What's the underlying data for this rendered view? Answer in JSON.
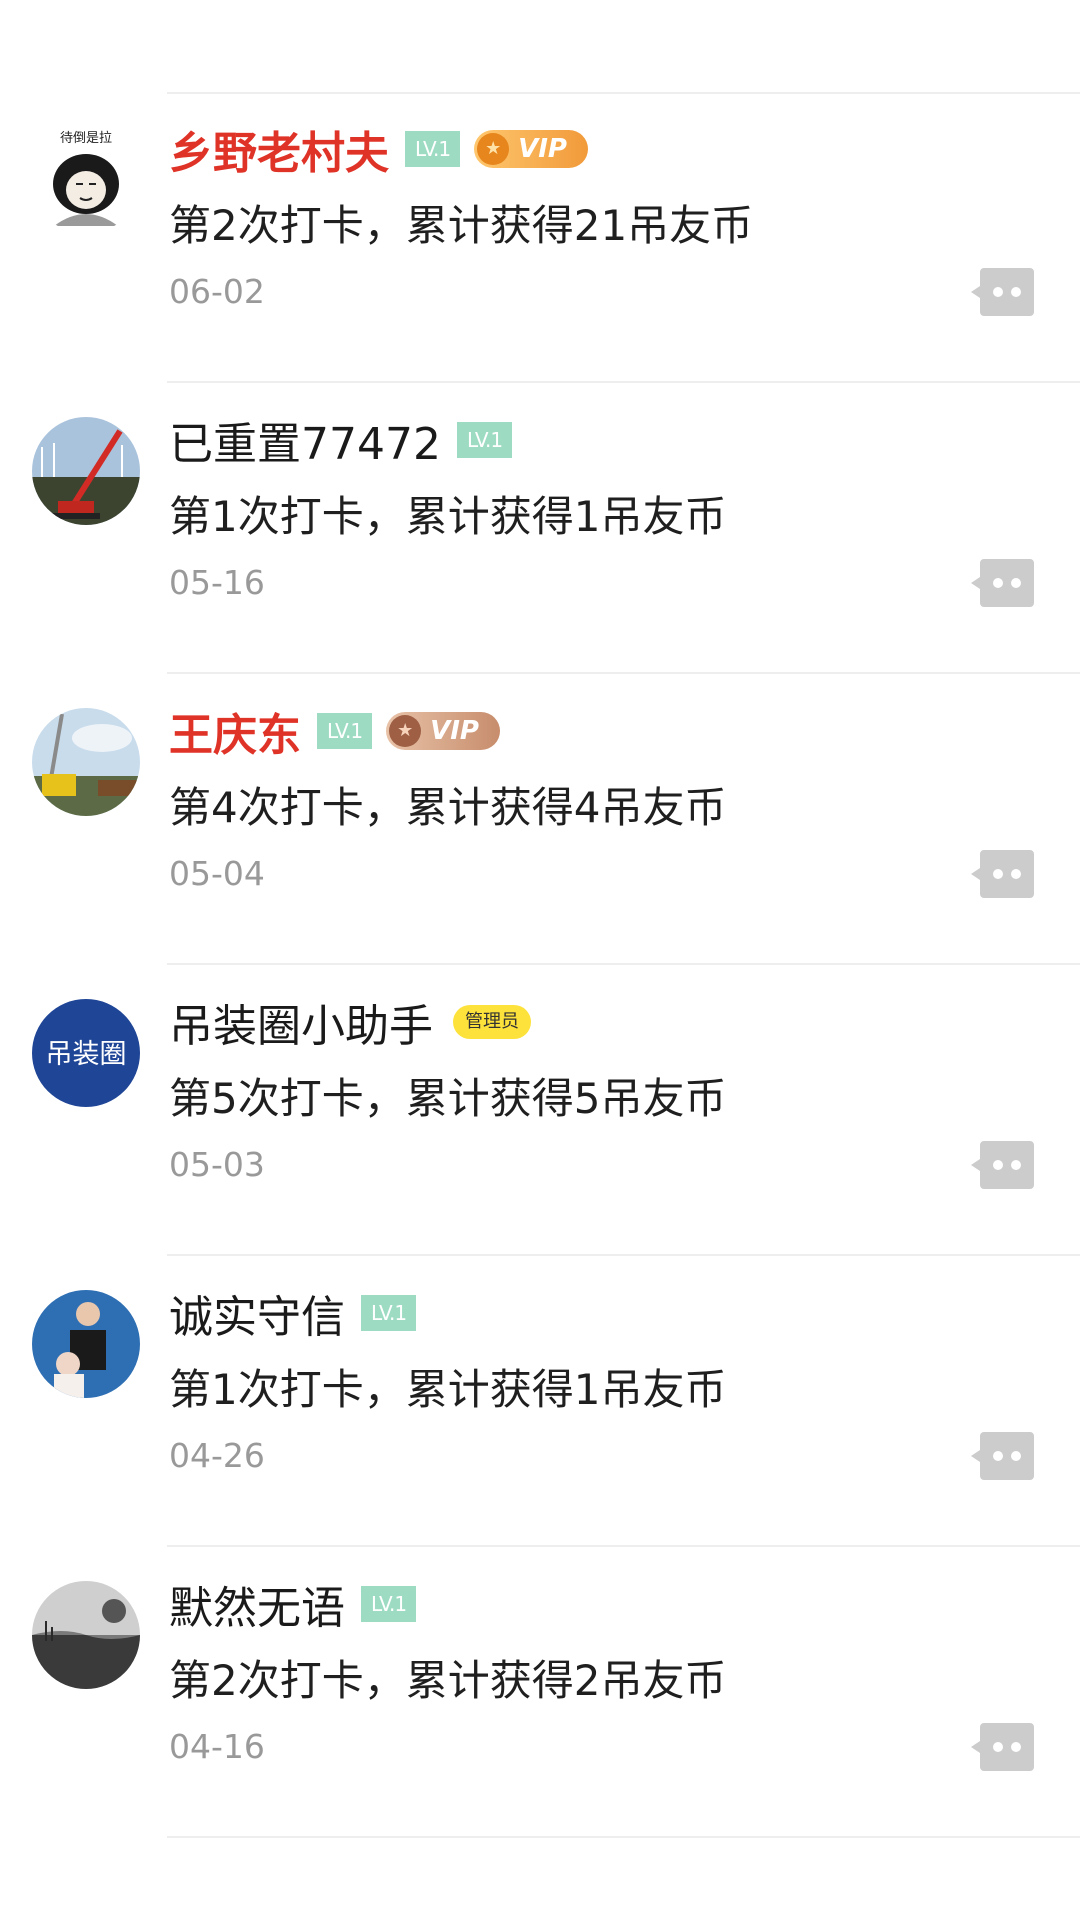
{
  "checkins": [
    {
      "username": "乡野老村夫",
      "level": "LV.1",
      "vip": "VIP",
      "vip_style": "gold",
      "content": "第2次打卡，累计获得21吊友币",
      "date": "06-02",
      "avatar_text": "待倒是拉"
    },
    {
      "username": "已重置77472",
      "level": "LV.1",
      "content": "第1次打卡，累计获得1吊友币",
      "date": "05-16"
    },
    {
      "username": "王庆东",
      "level": "LV.1",
      "vip": "VIP",
      "vip_style": "bronze",
      "content": "第4次打卡，累计获得4吊友币",
      "date": "05-04"
    },
    {
      "username": "吊装圈小助手",
      "role_badge": "管理员",
      "content": "第5次打卡，累计获得5吊友币",
      "date": "05-03",
      "avatar_text": "吊装圈"
    },
    {
      "username": "诚实守信",
      "level": "LV.1",
      "content": "第1次打卡，累计获得1吊友币",
      "date": "04-26"
    },
    {
      "username": "默然无语",
      "level": "LV.1",
      "content": "第2次打卡，累计获得2吊友币",
      "date": "04-16"
    }
  ],
  "icons": {
    "comment": "comment-bubble-icon",
    "vip_coin": "vip-coin-icon"
  },
  "colors": {
    "vip_name": "#e03328",
    "level_badge": "#9ddcc3",
    "admin_badge": "#fde23b",
    "date_text": "#999999",
    "comment_icon": "#cccccc"
  }
}
